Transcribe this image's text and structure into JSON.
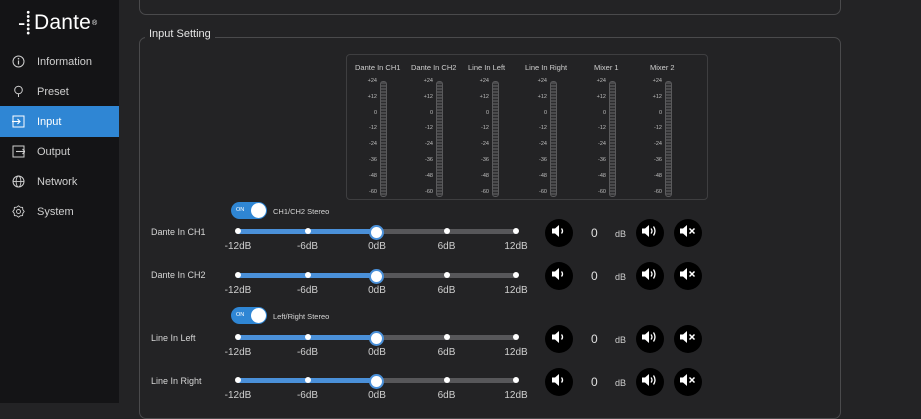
{
  "app": {
    "logo_text": "Dante",
    "logo_mark": "-⸽",
    "logo_reg": "®"
  },
  "sidebar": {
    "items": [
      {
        "label": "Information",
        "icon": "info-icon",
        "active": false
      },
      {
        "label": "Preset",
        "icon": "preset-icon",
        "active": false
      },
      {
        "label": "Input",
        "icon": "input-icon",
        "active": true
      },
      {
        "label": "Output",
        "icon": "output-icon",
        "active": false
      },
      {
        "label": "Network",
        "icon": "globe-icon",
        "active": false
      },
      {
        "label": "System",
        "icon": "gear-icon",
        "active": false
      }
    ]
  },
  "section": {
    "title": "Input Setting"
  },
  "meters": {
    "scale": [
      "+24",
      "+12",
      "0",
      "-12",
      "-24",
      "-36",
      "-48",
      "-60"
    ],
    "channels": [
      "Dante In CH1",
      "Dante In CH2",
      "Line In Left",
      "Line In Right",
      "Mixer 1",
      "Mixer 2"
    ]
  },
  "stereo_toggles": [
    {
      "state": "ON",
      "label": "CH1/CH2 Stereo"
    },
    {
      "state": "ON",
      "label": "Left/Right Stereo"
    }
  ],
  "slider_ticks": [
    "-12dB",
    "-6dB",
    "0dB",
    "6dB",
    "12dB"
  ],
  "channels": [
    {
      "label": "Dante In CH1",
      "gain": "0",
      "unit": "dB",
      "level_fraction": 0.5
    },
    {
      "label": "Dante In CH2",
      "gain": "0",
      "unit": "dB",
      "level_fraction": 0.5
    },
    {
      "label": "Line In Left",
      "gain": "0",
      "unit": "dB",
      "level_fraction": 0.5
    },
    {
      "label": "Line In Right",
      "gain": "0",
      "unit": "dB",
      "level_fraction": 0.5
    }
  ],
  "colors": {
    "accent": "#2f86d4",
    "slider_fill": "#4a90d9",
    "sidebar_bg": "#141416",
    "page_bg": "#232325"
  }
}
